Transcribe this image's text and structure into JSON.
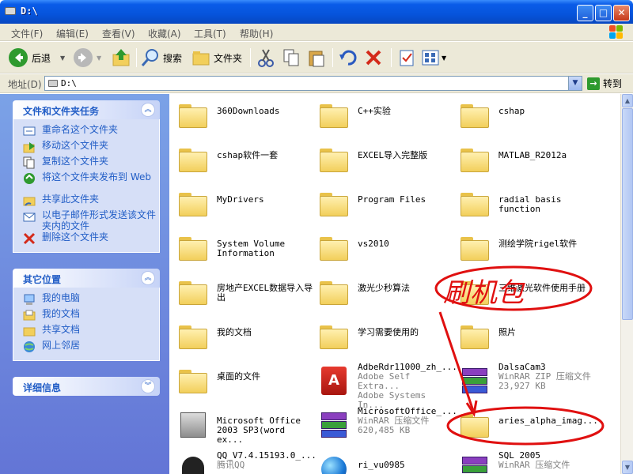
{
  "window": {
    "title": "D:\\"
  },
  "menu": [
    "文件(F)",
    "编辑(E)",
    "查看(V)",
    "收藏(A)",
    "工具(T)",
    "帮助(H)"
  ],
  "toolbar": {
    "back_label": "后退",
    "search_label": "搜索",
    "folders_label": "文件夹"
  },
  "address": {
    "label": "地址(D)",
    "value": "D:\\",
    "go_label": "转到"
  },
  "tasks_panel": {
    "title": "文件和文件夹任务",
    "items": [
      "重命名这个文件夹",
      "移动这个文件夹",
      "复制这个文件夹",
      "将这个文件夹发布到 Web",
      "共享此文件夹",
      "以电子邮件形式发送该文件夹内的文件",
      "删除这个文件夹"
    ]
  },
  "places_panel": {
    "title": "其它位置",
    "items": [
      "我的电脑",
      "我的文档",
      "共享文档",
      "网上邻居"
    ]
  },
  "details_panel": {
    "title": "详细信息"
  },
  "files": [
    {
      "name": "360Downloads",
      "type": "folder"
    },
    {
      "name": "C++实验",
      "type": "folder"
    },
    {
      "name": "cshap",
      "type": "folder"
    },
    {
      "name": "cshap软件一套",
      "type": "folder"
    },
    {
      "name": "EXCEL导入完整版",
      "type": "folder"
    },
    {
      "name": "MATLAB_R2012a",
      "type": "folder"
    },
    {
      "name": "MyDrivers",
      "type": "folder"
    },
    {
      "name": "Program Files",
      "type": "folder"
    },
    {
      "name": "radial basis function",
      "type": "folder"
    },
    {
      "name": "System Volume Information",
      "type": "folder"
    },
    {
      "name": "vs2010",
      "type": "folder"
    },
    {
      "name": "测绘学院rigel软件",
      "type": "folder"
    },
    {
      "name": "房地产EXCEL数据导入导出",
      "type": "folder"
    },
    {
      "name": "激光少秒算法",
      "type": "folder"
    },
    {
      "name": "三维激光软件使用手册",
      "type": "folder"
    },
    {
      "name": "我的文档",
      "type": "folder"
    },
    {
      "name": "学习需要使用的",
      "type": "folder"
    },
    {
      "name": "照片",
      "type": "folder"
    },
    {
      "name": "桌面的文件",
      "type": "folder"
    },
    {
      "name": "AdbeRdr11000_zh_...",
      "type": "pdf",
      "sub1": "Adobe Self Extra...",
      "sub2": "Adobe Systems In..."
    },
    {
      "name": "DalsaCam3",
      "type": "rar",
      "sub1": "WinRAR ZIP 压缩文件",
      "sub2": "23,927 KB"
    },
    {
      "name": "Microsoft Office 2003 SP3(word ex...",
      "type": "setup"
    },
    {
      "name": "MicrosoftOffice_...",
      "type": "rar",
      "sub1": "WinRAR 压缩文件",
      "sub2": "620,485 KB"
    },
    {
      "name": "aries_alpha_imag...",
      "type": "folder"
    },
    {
      "name": "QQ_V7.4.15193.0_...",
      "type": "qq",
      "sub1": "腾讯QQ"
    },
    {
      "name": "ri_vu0985",
      "type": "globe"
    },
    {
      "name": "SQL 2005",
      "type": "rar",
      "sub1": "WinRAR 压缩文件"
    }
  ],
  "annotation": {
    "text": "刷机包",
    "color": "#e01010"
  }
}
